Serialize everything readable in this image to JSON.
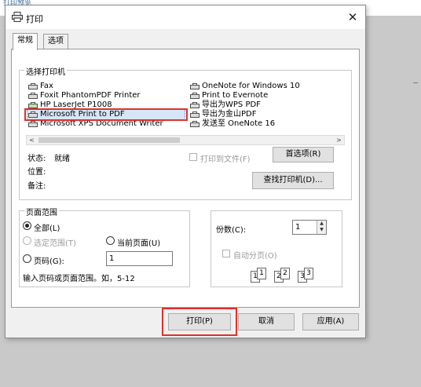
{
  "background": {
    "corner_text": "打印预览"
  },
  "dialog": {
    "title": "打印",
    "close_glyph": "✕"
  },
  "tabs": [
    {
      "label": "常规"
    },
    {
      "label": "选项"
    }
  ],
  "select_printer": {
    "group_label": "选择打印机",
    "printers": [
      {
        "name": "Fax"
      },
      {
        "name": "Foxit PhantomPDF Printer"
      },
      {
        "name": "HP LaserJet P1008"
      },
      {
        "name": "Microsoft Print to PDF"
      },
      {
        "name": "Microsoft XPS Document Writer"
      },
      {
        "name": "OneNote for Windows 10"
      },
      {
        "name": "Print to Evernote"
      },
      {
        "name": "导出为WPS PDF"
      },
      {
        "name": "导出为金山PDF"
      },
      {
        "name": "发送至 OneNote 16"
      }
    ],
    "selected": "Microsoft Print to PDF",
    "scroll_left": "<",
    "scroll_right": ">"
  },
  "status": {
    "status_label": "状态:",
    "status_value": "就绪",
    "location_label": "位置:",
    "comment_label": "备注:"
  },
  "print_to_file": {
    "label": "打印到文件(F)",
    "checked": false
  },
  "buttons": {
    "preferences": "首选项(R)",
    "find_printer": "查找打印机(D)...",
    "print": "打印(P)",
    "cancel": "取消",
    "apply": "应用(A)"
  },
  "page_range": {
    "group_label": "页面范围",
    "all": "全部(L)",
    "selection": "选定范围(T)",
    "current_page": "当前页面(U)",
    "pages": "页码(G):",
    "pages_value": "1",
    "hint": "输入页码或页面范围。如，5-12",
    "selected_option": "all"
  },
  "copies": {
    "label": "份数(C):",
    "value": "1",
    "collate_label": "自动分页(O)",
    "collate_checked": false,
    "collate_pages": [
      "1",
      "1",
      "2",
      "2",
      "3",
      "3"
    ]
  },
  "colors": {
    "highlight": "#e0302b",
    "selection_bg": "#d6e6f7"
  }
}
